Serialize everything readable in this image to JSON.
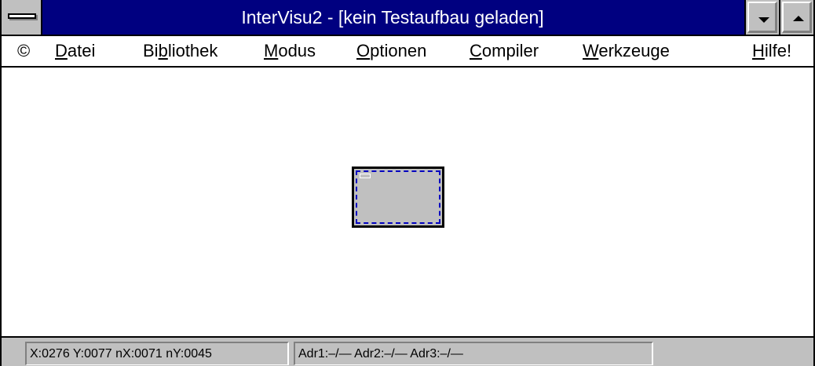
{
  "window": {
    "title": "InterVisu2 - [kein Testaufbau geladen]"
  },
  "menu": {
    "copyright": "©",
    "items": [
      {
        "label": "Datei",
        "accel": "D",
        "rest": "atei"
      },
      {
        "label": "Bibliothek",
        "pre": "Bi",
        "accel": "b",
        "rest": "liothek"
      },
      {
        "label": "Modus",
        "accel": "M",
        "rest": "odus"
      },
      {
        "label": "Optionen",
        "accel": "O",
        "rest": "ptionen"
      },
      {
        "label": "Compiler",
        "accel": "C",
        "rest": "ompiler"
      },
      {
        "label": "Werkzeuge",
        "accel": "W",
        "rest": "erkzeuge"
      },
      {
        "label": "Hilfe!",
        "accel": "H",
        "rest": "ilfe!"
      }
    ]
  },
  "status": {
    "coords": "X:0276 Y:0077 nX:0071 nY:0045",
    "addresses": "Adr1:–/— Adr2:–/— Adr3:–/—",
    "extra": ""
  },
  "colors": {
    "titlebar": "#000080",
    "face": "#c0c0c0",
    "selection_dash": "#0000c0"
  },
  "icons": {
    "system_menu": "system-menu-icon",
    "minimize": "triangle-down-icon",
    "maximize": "triangle-up-icon"
  }
}
